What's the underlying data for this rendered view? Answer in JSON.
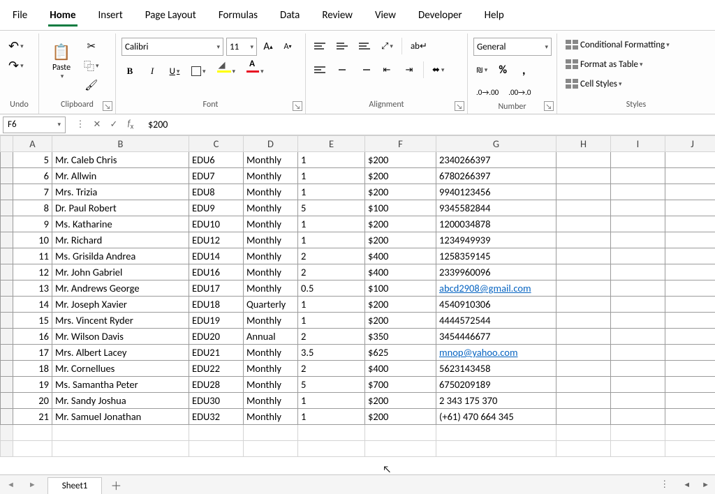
{
  "menu": {
    "file": "File",
    "home": "Home",
    "insert": "Insert",
    "pagelayout": "Page Layout",
    "formulas": "Formulas",
    "data": "Data",
    "review": "Review",
    "view": "View",
    "developer": "Developer",
    "help": "Help"
  },
  "ribbon": {
    "undo_label": "Undo",
    "clipboard_label": "Clipboard",
    "paste_label": "Paste",
    "font_label": "Font",
    "font_name": "Calibri",
    "font_size": "11",
    "alignment_label": "Alignment",
    "number_label": "Number",
    "number_format": "General",
    "styles_label": "Styles",
    "cond_fmt": "Conditional Formatting",
    "fmt_table": "Format as Table",
    "cell_styles": "Cell Styles"
  },
  "formula_bar": {
    "namebox": "F6",
    "formula": "$200"
  },
  "columns": [
    "A",
    "B",
    "C",
    "D",
    "E",
    "F",
    "G",
    "H",
    "I",
    "J"
  ],
  "rows": [
    {
      "r": "",
      "a": "5",
      "b": "Mr. Caleb Chris",
      "c": "EDU6",
      "d": "Monthly",
      "e": "1",
      "f": "$200",
      "g": "2340266397",
      "glink": false
    },
    {
      "r": "",
      "a": "6",
      "b": "Mr. Allwin",
      "c": "EDU7",
      "d": "Monthly",
      "e": "1",
      "f": "$200",
      "g": "6780266397",
      "glink": false
    },
    {
      "r": "",
      "a": "7",
      "b": "Mrs. Trizia",
      "c": "EDU8",
      "d": "Monthly",
      "e": "1",
      "f": "$200",
      "g": "9940123456",
      "glink": false
    },
    {
      "r": "",
      "a": "8",
      "b": "Dr. Paul Robert",
      "c": "EDU9",
      "d": "Monthly",
      "e": "5",
      "f": "$100",
      "g": "9345582844",
      "glink": false
    },
    {
      "r": "",
      "a": "9",
      "b": "Ms. Katharine",
      "c": "EDU10",
      "d": "Monthly",
      "e": "1",
      "f": "$200",
      "g": "1200034878",
      "glink": false
    },
    {
      "r": "",
      "a": "10",
      "b": "Mr. Richard",
      "c": "EDU12",
      "d": "Monthly",
      "e": "1",
      "f": "$200",
      "g": "1234949939",
      "glink": false
    },
    {
      "r": "",
      "a": "11",
      "b": "Ms. Grisilda Andrea",
      "c": "EDU14",
      "d": "Monthly",
      "e": "2",
      "f": "$400",
      "g": "1258359145",
      "glink": false
    },
    {
      "r": "",
      "a": "12",
      "b": "Mr. John Gabriel",
      "c": "EDU16",
      "d": "Monthly",
      "e": "2",
      "f": "$400",
      "g": "2339960096",
      "glink": false
    },
    {
      "r": "",
      "a": "13",
      "b": "Mr. Andrews George",
      "c": "EDU17",
      "d": "Monthly",
      "e": "0.5",
      "f": "$100",
      "g": "abcd2908@gmail.com",
      "glink": true
    },
    {
      "r": "",
      "a": "14",
      "b": "Mr. Joseph Xavier",
      "c": "EDU18",
      "d": "Quarterly",
      "e": "1",
      "f": "$200",
      "g": "4540910306",
      "glink": false
    },
    {
      "r": "",
      "a": "15",
      "b": "Mrs. Vincent Ryder",
      "c": "EDU19",
      "d": "Monthly",
      "e": "1",
      "f": "$200",
      "g": "4444572544",
      "glink": false
    },
    {
      "r": "",
      "a": "16",
      "b": "Mr. Wilson Davis",
      "c": "EDU20",
      "d": "Annual",
      "e": "2",
      "f": "$350",
      "g": "3454446677",
      "glink": false
    },
    {
      "r": "",
      "a": "17",
      "b": "Mrs. Albert Lacey",
      "c": "EDU21",
      "d": "Monthly",
      "e": "3.5",
      "f": "$625",
      "g": "mnop@yahoo.com",
      "glink": true
    },
    {
      "r": "",
      "a": "18",
      "b": "Mr. Cornellues",
      "c": "EDU22",
      "d": "Monthly",
      "e": "2",
      "f": "$400",
      "g": "5623143458",
      "glink": false
    },
    {
      "r": "",
      "a": "19",
      "b": "Ms. Samantha Peter",
      "c": "EDU28",
      "d": "Monthly",
      "e": "5",
      "f": "$700",
      "g": "6750209189",
      "glink": false
    },
    {
      "r": "",
      "a": "20",
      "b": "Mr. Sandy Joshua",
      "c": "EDU30",
      "d": "Monthly",
      "e": "1",
      "f": "$200",
      "g": "2 343 175 370",
      "glink": false
    },
    {
      "r": "",
      "a": "21",
      "b": "Mr. Samuel Jonathan",
      "c": "EDU32",
      "d": "Monthly",
      "e": "1",
      "f": "$200",
      "g": "(+61) 470 664 345",
      "glink": false
    }
  ],
  "sheet_tab": "Sheet1"
}
